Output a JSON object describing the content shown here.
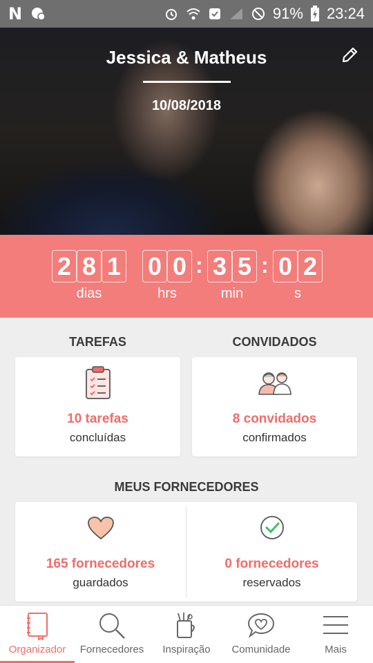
{
  "status_bar": {
    "battery": "91%",
    "time": "23:24",
    "left_letter": "N"
  },
  "hero": {
    "title": "Jessica & Matheus",
    "date": "10/08/2018"
  },
  "countdown": {
    "days_digits": [
      "2",
      "8",
      "1"
    ],
    "hours_digits": [
      "0",
      "0"
    ],
    "minutes_digits": [
      "3",
      "5"
    ],
    "seconds_digits": [
      "0",
      "2"
    ],
    "separator": ":",
    "labels": {
      "days": "dias",
      "hours": "hrs",
      "minutes": "min",
      "seconds": "s"
    }
  },
  "tarefas": {
    "title": "TAREFAS",
    "value": "10 tarefas",
    "sub": "concluídas"
  },
  "convidados": {
    "title": "CONVIDADOS",
    "value": "8 convidados",
    "sub": "confirmados"
  },
  "fornecedores": {
    "title": "MEUS FORNECEDORES",
    "saved_value": "165 fornecedores",
    "saved_sub": "guardados",
    "booked_value": "0 fornecedores",
    "booked_sub": "reservados"
  },
  "nav": {
    "items": [
      {
        "label": "Organizador",
        "icon": "notebook-icon",
        "active": true
      },
      {
        "label": "Fornecedores",
        "icon": "search-icon"
      },
      {
        "label": "Inspiração",
        "icon": "inspiration-icon"
      },
      {
        "label": "Comunidade",
        "icon": "heart-chat-icon"
      },
      {
        "label": "Mais",
        "icon": "menu-icon"
      }
    ]
  },
  "colors": {
    "accent": "#f27d7a",
    "accent_text": "#f06c69",
    "status_bar": "#6f6f6f"
  }
}
